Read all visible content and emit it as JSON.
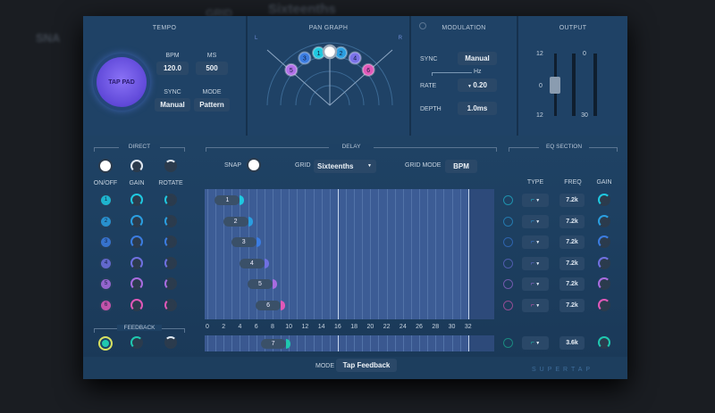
{
  "background": {
    "snap": "SNA",
    "grid": "GRID",
    "grid_value": "Sixteenths"
  },
  "tempo": {
    "title": "TEMPO",
    "tap_pad": "TAP PAD",
    "bpm_label": "BPM",
    "bpm": "120.0",
    "ms_label": "MS",
    "ms": "500",
    "sync_label": "SYNC",
    "sync": "Manual",
    "mode_label": "MODE",
    "mode": "Pattern"
  },
  "pan": {
    "title": "PAN GRAPH",
    "left": "L",
    "right": "R",
    "taps": [
      {
        "n": "1",
        "angle": -12,
        "color": "#1fc8e0"
      },
      {
        "n": "2",
        "angle": 12,
        "color": "#2a9ee0"
      },
      {
        "n": "3",
        "angle": -28,
        "color": "#3b7ce0"
      },
      {
        "n": "4",
        "angle": 28,
        "color": "#7a72e8"
      },
      {
        "n": "5",
        "angle": -46,
        "color": "#b070e8"
      },
      {
        "n": "6",
        "angle": 46,
        "color": "#e058b8"
      }
    ]
  },
  "modulation": {
    "title": "MODULATION",
    "sync_label": "SYNC",
    "sync": "Manual",
    "hz": "Hz",
    "rate_label": "RATE",
    "rate": "0.20",
    "depth_label": "DEPTH",
    "depth": "1.0ms"
  },
  "output": {
    "title": "OUTPUT",
    "fader_top": "12",
    "fader_mid": "0",
    "fader_bot": "12",
    "meter_top": "0",
    "meter_bot": "30",
    "fader_db": 0
  },
  "direct": {
    "title": "DIRECT",
    "onoff": "ON/OFF",
    "gain": "GAIN",
    "rotate": "ROTATE"
  },
  "delay": {
    "title": "DELAY",
    "snap": "SNAP",
    "grid_label": "GRID",
    "grid": "Sixteenths",
    "grid_mode_label": "GRID MODE",
    "grid_mode": "BPM",
    "ticks": [
      "0",
      "2",
      "4",
      "6",
      "8",
      "10",
      "12",
      "14",
      "16",
      "18",
      "20",
      "22",
      "24",
      "26",
      "28",
      "30",
      "32"
    ],
    "max": 34.5,
    "taps": [
      {
        "n": "1",
        "time": 4,
        "color": "#1fc8e0"
      },
      {
        "n": "2",
        "time": 5,
        "color": "#2a9ee0"
      },
      {
        "n": "3",
        "time": 6,
        "color": "#3b7ce0"
      },
      {
        "n": "4",
        "time": 7,
        "color": "#6f70e0"
      },
      {
        "n": "5",
        "time": 8,
        "color": "#a86ce0"
      },
      {
        "n": "6",
        "time": 9,
        "color": "#e058b8"
      }
    ],
    "feedback_tap": {
      "n": "7",
      "time": 9.6,
      "color": "#1fc8b0"
    }
  },
  "eq": {
    "title": "EQ SECTION",
    "type": "TYPE",
    "freq": "FREQ",
    "gain": "GAIN",
    "rows": [
      "7.2k",
      "7.2k",
      "7.2k",
      "7.2k",
      "7.2k",
      "7.2k"
    ],
    "feedback_freq": "3.6k"
  },
  "feedback": {
    "title": "FEEDBACK"
  },
  "mode": {
    "label": "MODE",
    "value": "Tap Feedback"
  },
  "brand": "SUPERTAP"
}
